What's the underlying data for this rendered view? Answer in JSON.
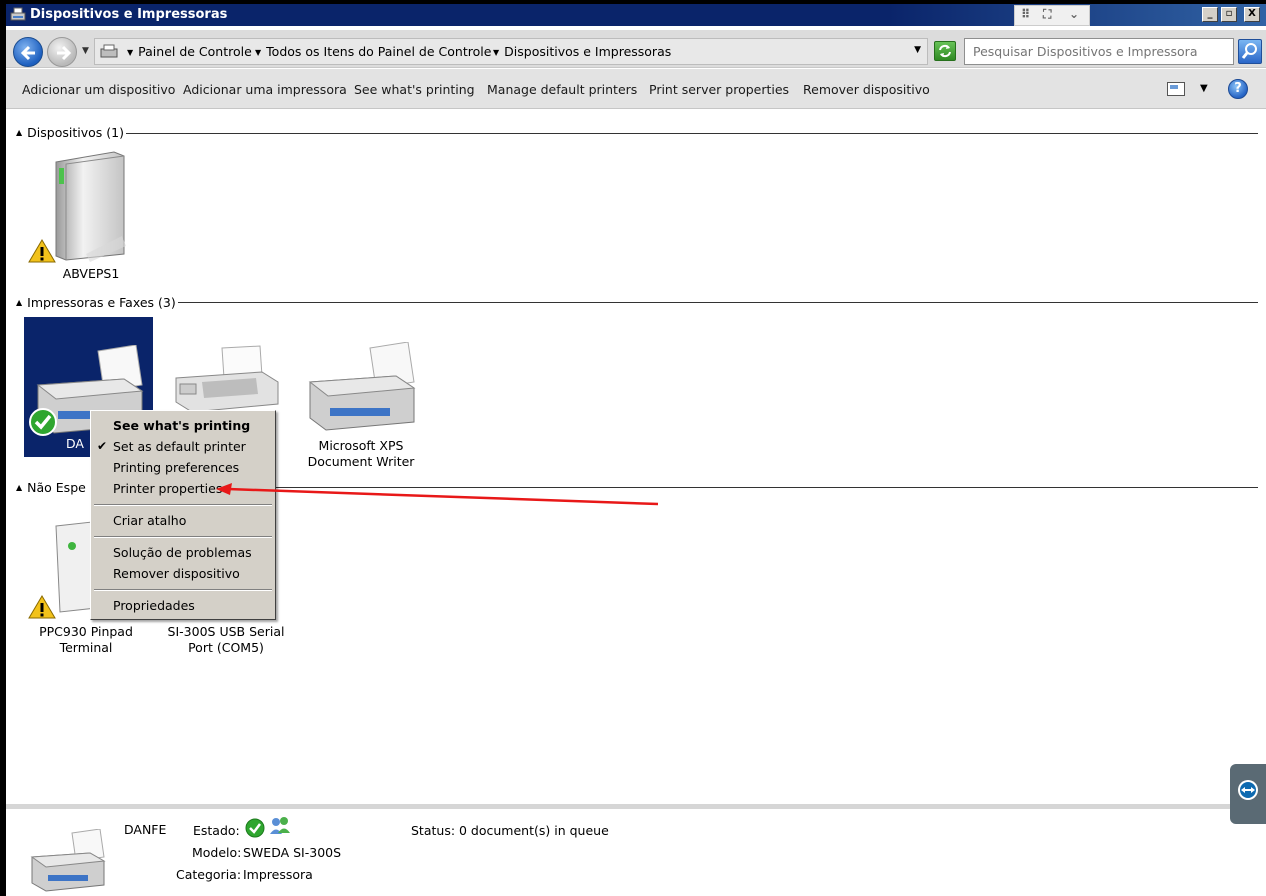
{
  "window": {
    "title": "Dispositivos e Impressoras",
    "buttons": {
      "minimize": "_",
      "maximize": "▫",
      "close": "X"
    }
  },
  "address": {
    "crumbs": [
      "Painel de Controle",
      "Todos os Itens do Painel de Controle",
      "Dispositivos e Impressoras"
    ],
    "search_placeholder": "Pesquisar Dispositivos e Impressoras"
  },
  "commands": [
    "Adicionar um dispositivo",
    "Adicionar uma impressora",
    "See what's printing",
    "Manage default printers",
    "Print server properties",
    "Remover dispositivo"
  ],
  "groups": {
    "devices": {
      "label": "Dispositivos (1)",
      "items": [
        "ABVEPS1"
      ]
    },
    "printers": {
      "label": "Impressoras e Faxes (3)",
      "items": [
        "DANFE",
        "Microsoft XPS Document Writer"
      ]
    },
    "unspecified": {
      "label": "Não Especificado (2)",
      "items": [
        "PPC930 Pinpad Terminal",
        "SI-300S USB Serial Port (COM5)"
      ]
    }
  },
  "device_labels": {
    "abveps1": "ABVEPS1",
    "danfe_partial": "DA",
    "xps_line1": "Microsoft XPS",
    "xps_line2": "Document Writer",
    "ppc_line1": "PPC930 Pinpad",
    "ppc_line2": "Terminal",
    "si_line1": "SI-300S USB Serial",
    "si_line2": "Port (COM5)",
    "unspecified_partial": "Não Espe"
  },
  "context_menu": {
    "items": [
      "See what's printing",
      "Set as default printer",
      "Printing preferences",
      "Printer properties",
      "Criar atalho",
      "Solução de problemas",
      "Remover dispositivo",
      "Propriedades"
    ],
    "checked": "Set as default printer",
    "bold": "See what's printing",
    "highlighted_by_arrow": "Printer properties"
  },
  "details": {
    "name": "DANFE",
    "estado_label": "Estado:",
    "modelo_label": "Modelo:",
    "modelo_value": "SWEDA SI-300S",
    "categoria_label": "Categoria:",
    "categoria_value": "Impressora",
    "status_label": "Status:",
    "status_value": "0 document(s) in queue"
  },
  "colors": {
    "selection": "#0a246a",
    "annotation_arrow": "#e81818",
    "menu_bg": "#d4d0c8"
  }
}
